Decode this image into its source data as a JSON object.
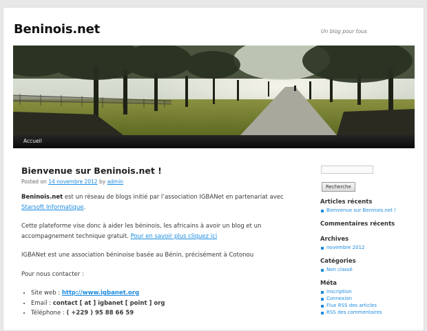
{
  "header": {
    "site_title": "Beninois.net",
    "tagline": "Un blog pour tous"
  },
  "nav": {
    "items": [
      "Accueil"
    ]
  },
  "post": {
    "title": "Bienvenue sur Beninois.net !",
    "meta": {
      "posted_on": "Posted on",
      "date": "14 novembre 2012",
      "by": "by",
      "author": "admin"
    },
    "p1": {
      "bold": "Beninois.net",
      "text": " est un réseau de blogs initié par l’association IGBANet en partenariat avec ",
      "link": "Starsoft Informatique",
      "end": "."
    },
    "p2": {
      "text": "Cette plateforme vise donc à aider les béninois, les africains à avoir un blog et un accompagnement technique gratuit. ",
      "link": "Pour en savoir plus cliquez ici"
    },
    "p3": "IGBANet est une association béninoise basée au Bénin, précisément à Cotonou",
    "p4": "Pour nous contacter  :",
    "contacts": {
      "site_label": "Site web : ",
      "site_link": "http://www.igbanet.org",
      "email_label": "Email : ",
      "email_value": "contact [ at ] igbanet [ point ] org",
      "phone_label": "Téléphone : ",
      "phone_value": "( +229 ) 95 88 66 59"
    }
  },
  "sidebar": {
    "search_button": "Recherche",
    "widgets": [
      {
        "title": "Articles récents",
        "items": [
          "Bienvenue sur Beninois.net !"
        ]
      },
      {
        "title": "Commentaires récents",
        "items": []
      },
      {
        "title": "Archives",
        "items": [
          "novembre 2012"
        ]
      },
      {
        "title": "Catégories",
        "items": [
          "Non classé"
        ]
      },
      {
        "title": "Méta",
        "items": [
          "Inscription",
          "Connexion",
          "Flux RSS des articles",
          "RSS des commentaires"
        ]
      }
    ]
  }
}
